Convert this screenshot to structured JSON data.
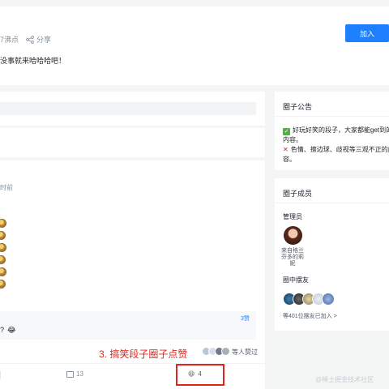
{
  "header": {
    "stat_text": "7沸点",
    "share_label": "分享",
    "join_label": "加入",
    "description": "没事就来哈哈哈吧！"
  },
  "post": {
    "time_text": "时前",
    "circle": {
      "count_text": "3赞",
      "snippet": "?"
    },
    "annotation": "3. 搞笑段子圈子点赞",
    "liked_text": "等人赞过",
    "comment_count": "13",
    "like_count": "4"
  },
  "sidebar": {
    "notice": {
      "title": "圈子公告",
      "line1": "好玩好笑的段子，大家都能get到的",
      "line2": "内容。",
      "line3": "色情、擦边球、歧视等三观不正的内",
      "line4": "容。"
    },
    "members": {
      "title": "圈子成员",
      "admins_label": "管理员",
      "admin_name": "来自格兰芬多的莉妮",
      "mods_label": "圈中摆友",
      "joined_text": "等401位摆友已加入 >"
    }
  },
  "watermark": "@稀土掘金技术社区",
  "colors": {
    "accent": "#1e80ff",
    "annotation_red": "#e0241b"
  }
}
